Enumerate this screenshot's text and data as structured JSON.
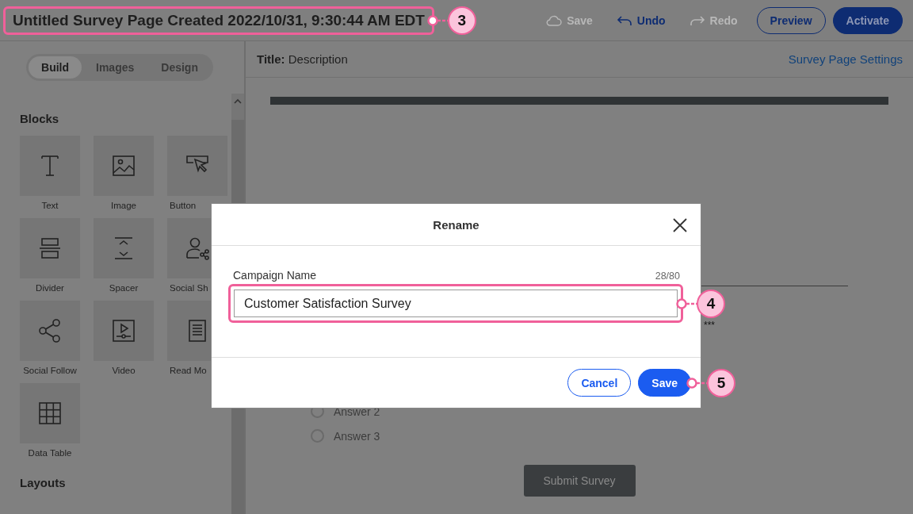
{
  "top_bar": {
    "title": {
      "text": "Untitled Survey Page Created 2022/10/31, 9:30:44 AM EDT",
      "callout": "3"
    },
    "actions": [
      {
        "label": "Save",
        "disabled": true
      },
      {
        "label": "Undo",
        "disabled": false
      },
      {
        "label": "Redo",
        "disabled": true
      }
    ],
    "buttons": [
      {
        "label": "Preview",
        "kind": "outline"
      },
      {
        "label": "Activate",
        "kind": "primary"
      }
    ]
  },
  "sidebar": {
    "tabs": [
      {
        "label": "Build",
        "selected": true
      },
      {
        "label": "Images",
        "selected": false
      },
      {
        "label": "Design",
        "selected": false
      }
    ],
    "sections": [
      {
        "heading": "Blocks",
        "blocks": [
          {
            "label": "Text"
          },
          {
            "label": "Image"
          },
          {
            "label": "Button"
          },
          {
            "label": "Divider"
          },
          {
            "label": "Spacer"
          },
          {
            "label": "Social Sh"
          },
          {
            "label": "Social Follow"
          },
          {
            "label": "Video"
          },
          {
            "label": "Read Mo"
          },
          {
            "label": "Data Table"
          }
        ]
      },
      {
        "heading": "Layouts"
      }
    ]
  },
  "main": {
    "header": {
      "title": "**Title:** Description",
      "link": "Survey Page Settings"
    },
    "canvas": {
      "rating_mark": "***",
      "answers": [
        {
          "label": "Answer 2",
          "selected": false
        },
        {
          "label": "Answer 3",
          "selected": false
        }
      ],
      "submit": "Submit Survey"
    }
  },
  "dialog": {
    "title": "Rename",
    "field": {
      "label": "Campaign Name",
      "counter": "28/80",
      "value": "Customer Satisfaction Survey",
      "callout": "4"
    },
    "buttons": [
      {
        "label": "Cancel",
        "kind": "secondary"
      },
      {
        "label": "Save",
        "kind": "primary",
        "callout": "5"
      }
    ]
  }
}
